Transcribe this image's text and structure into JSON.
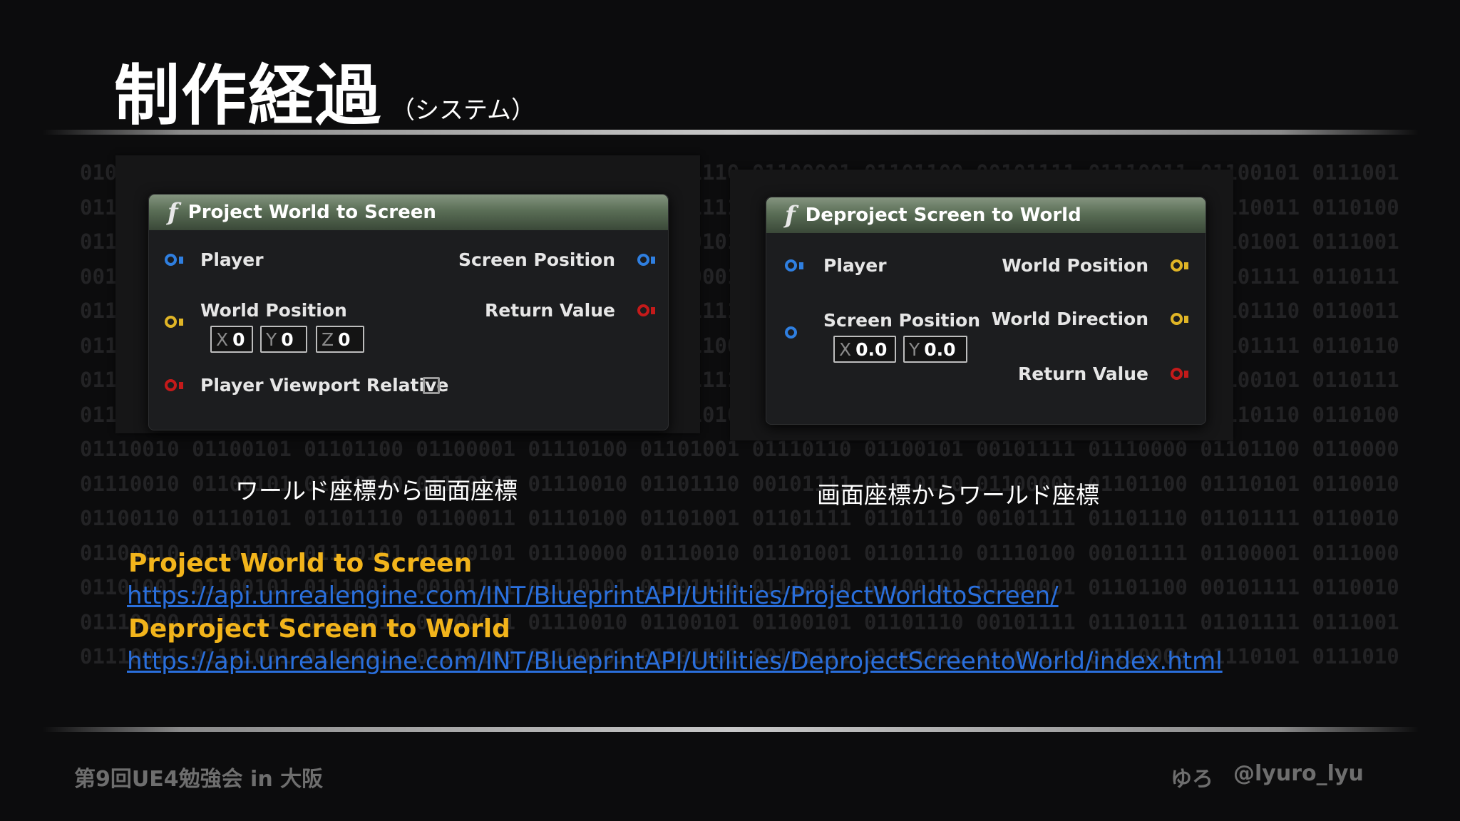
{
  "slide": {
    "title": "制作経過",
    "subtitle": "（システム）"
  },
  "background": {
    "binary_lines": [
      "01001111 01110010 01101001 01100111 01101001 01101110 01100001 01101100 00101111 01110011 01100101 01110011 01110011 01101001 01101111 01101110 01110011 01101001",
      "01110100 01101001 01101111 01101110 01110011 00101111 01100100 01101001 01110011 01101011 01110011 01101000 01101111 01110111 00101111 01010111 01100101 01100010 00101111",
      "01100011 01101111 01101101 00101111 01101000 01100101 01101100 01110000 00101111 01101100 01101001 01110011 01110100 01100101 01101110 01101001 01101110 01100111 01101101",
      "00101111 01110010 01100101 01110011 01110100 01100001 01101100 01101100 01111001 00101111 01101111 01101110 01100101 01110011 01101001 01101101 01110000 01101100 01100101",
      "01101000 01100001 01110000 01110000 01111001 00101111 01100001 01100100 01100100 01101001 01101110 01100111 00101111 01101001 01101110 01101001 01110100 01101001 00101111",
      "01110011 01100001 01101110 01100111 00101111 01101100 01101111 01100011 01100001 01101100 00101111 01101100 01100001 01101110 01100111 01110101 01100001 01100111 00101111",
      "01110111 01101111 01110010 01101100 01100100 00101111 01110011 01100011 01110010 01100101 01100101 01101110 00101111 01110000 01110010 01101111 01101010 01100101 01100011",
      "01100100 01100101 01110000 01110010 01101111 01101010 01100101 01100011 01110100 00101111 01110110 01101001 01100101 01110111 01110000 01101111 01110010 01110100 01100101",
      "01110010 01100101 01101100 01100001 01110100 01101001 01110110 01100101 00101111 01110000 01101100 01100001 01111001 01100101 01110010 00101111 01101110 01101111 01100100",
      "01110010 01100101 01110100 01110101 01110010 01101110 00101111 01110110 01100001 01101100 01110101 01100101 00101111 01100100 01101001 01110010 01100101 01100011 01110100",
      "01100110 01110101 01101110 01100011 01110100 01101001 01101111 01101110 00101111 01101110 01101111 01100100 01100101 01110011 01101001 01100111 01101110 01100001 01101100",
      "01100010 01101100 01110101 01100101 01110000 01110010 01101001 01101110 01110100 00101111 01100001 01110000 01101001 01110101 01110100 01101001 01101100 01101001 01110100",
      "01101001 01100101 01110011 00101111 01110101 01101110 01110010 01100101 01100001 01101100 00101111 01100101 01101110 01100111 01101001 01101110 01100101 01101001 01101110",
      "01110100 01101111 01110011 01100011 01110010 01100101 01100101 01101110 00101111 01110111 01101111 01110010 01101100 01100100 00101111 01101001 01101110 01100100 01100101",
      "01110011 01111001 01110011 01110100 01100101 01101101 00101111 01101001 01101110 01110000 01110101 01110100 00101111 01101101 01101111 01110101 01110011 01100101 01110100"
    ]
  },
  "node_project": {
    "title": "Project World to Screen",
    "player": "Player",
    "world_position": "World Position",
    "vec": {
      "x_axis": "X",
      "x_val": "0",
      "y_axis": "Y",
      "y_val": "0",
      "z_axis": "Z",
      "z_val": "0"
    },
    "viewport_relative": "Player Viewport Relative",
    "screen_position": "Screen Position",
    "return_value": "Return Value",
    "viewport_relative_checked": false
  },
  "node_deproject": {
    "title": "Deproject Screen to World",
    "player": "Player",
    "screen_position": "Screen Position",
    "vec": {
      "x_axis": "X",
      "x_val": "0.0",
      "y_axis": "Y",
      "y_val": "0.0"
    },
    "world_position": "World Position",
    "world_direction": "World Direction",
    "return_value": "Return Value"
  },
  "captions": {
    "left": "ワールド座標から画面座標",
    "right": "画面座標からワールド座標"
  },
  "references": [
    {
      "title": "Project World to Screen",
      "url": "https://api.unrealengine.com/INT/BlueprintAPI/Utilities/ProjectWorldtoScreen/"
    },
    {
      "title": "Deproject Screen to World",
      "url": "https://api.unrealengine.com/INT/BlueprintAPI/Utilities/DeprojectScreentoWorld/index.html"
    }
  ],
  "footer": {
    "event": "第9回UE4勉強会 in 大阪",
    "author": "ゆろ",
    "handle": "@lyuro_lyu"
  },
  "colors": {
    "pin_object": "#2f7fe0",
    "pin_vector": "#e0b526",
    "pin_bool": "#c41a1a",
    "ref_title": "#f2b41b",
    "ref_link": "#2a6fdc"
  }
}
